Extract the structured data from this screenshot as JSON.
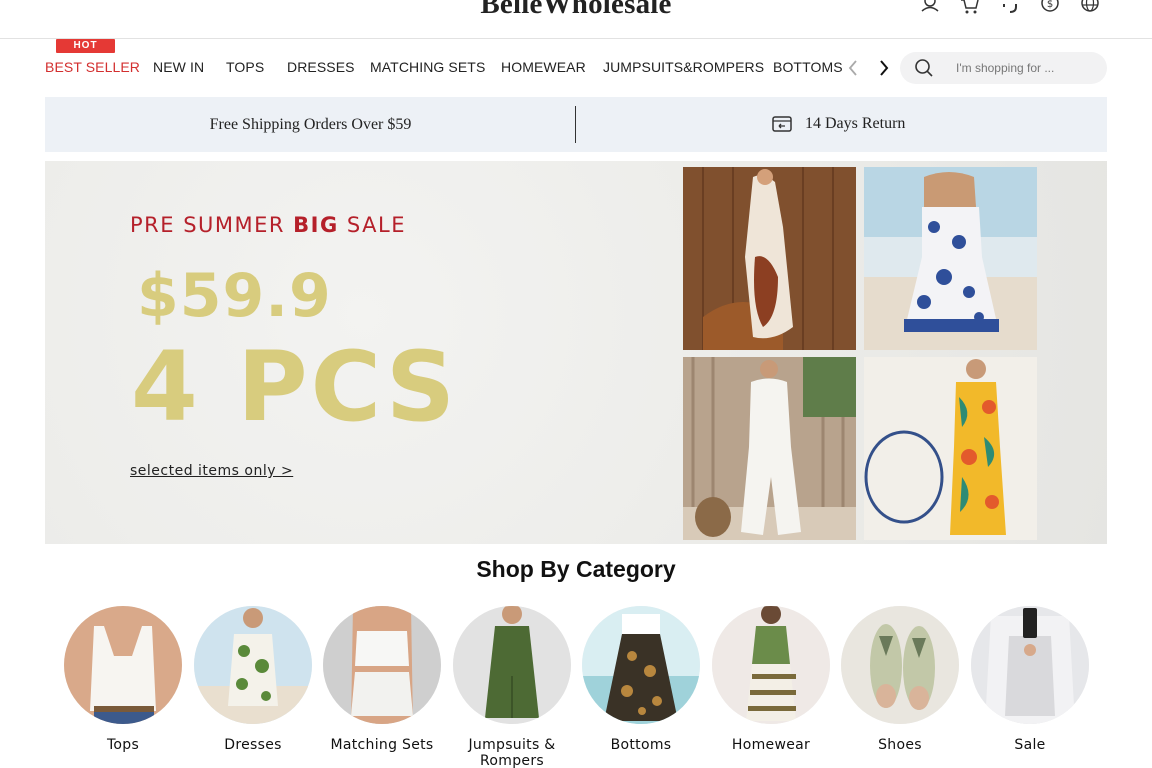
{
  "brand": {
    "logo": "BelleWholesale"
  },
  "header": {
    "icons": [
      "user-icon",
      "cart-icon",
      "headset-icon",
      "currency-icon",
      "globe-icon"
    ]
  },
  "nav": {
    "hot_badge": "HOT",
    "items": [
      "BEST SELLER",
      "NEW IN",
      "TOPS",
      "DRESSES",
      "MATCHING SETS",
      "HOMEWEAR",
      "JUMPSUITS&ROMPERS",
      "BOTTOMS"
    ],
    "active_color": "#d32f2f"
  },
  "search": {
    "placeholder": "I'm shopping for ..."
  },
  "info_bar": {
    "shipping": "Free Shipping Orders Over $59",
    "return": "14 Days Return"
  },
  "banner": {
    "pre_1": "PRE SUMMER ",
    "pre_bold": "BIG",
    "pre_2": " SALE",
    "price": "$59.9",
    "pcs": "4 PCS",
    "link": "selected items only >",
    "accent": "#b5202a",
    "gold": "#d8cc7e"
  },
  "categories": {
    "title": "Shop By Category",
    "items": [
      {
        "label": "Tops"
      },
      {
        "label": "Dresses"
      },
      {
        "label": "Matching Sets"
      },
      {
        "label": "Jumpsuits & Rompers"
      },
      {
        "label": "Bottoms"
      },
      {
        "label": "Homewear"
      },
      {
        "label": "Shoes"
      },
      {
        "label": "Sale"
      }
    ]
  }
}
